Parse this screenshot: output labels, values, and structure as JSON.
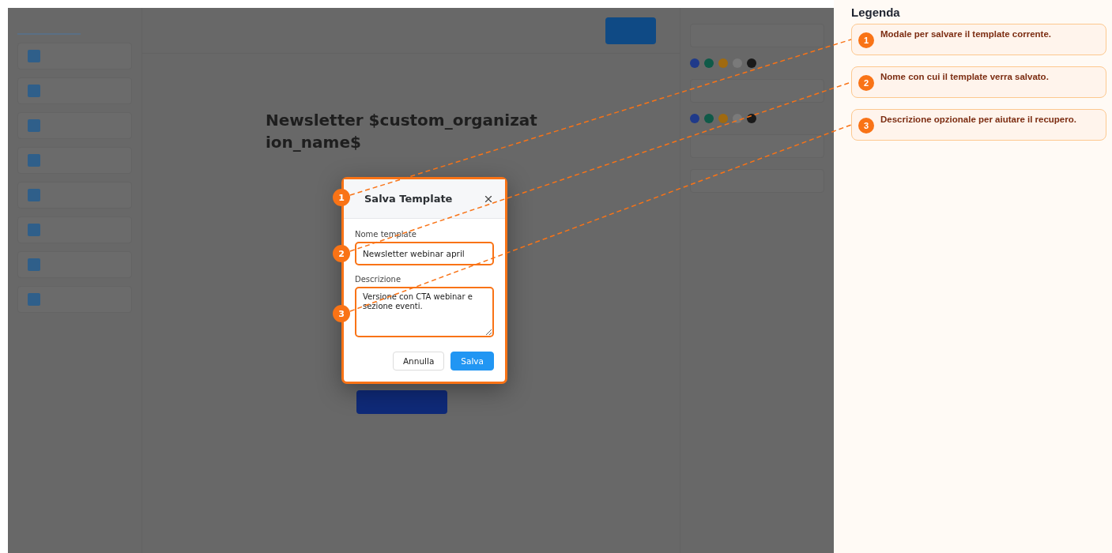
{
  "background": {
    "heading": "Newsletter $custom_organization_name$"
  },
  "modal": {
    "title": "Salva Template",
    "fields": [
      {
        "kind": "input",
        "label": "Nome template",
        "value": "Newsletter webinar april"
      },
      {
        "kind": "textarea",
        "label": "Descrizione",
        "value": "Versione con CTA webinar e sezione eventi."
      }
    ],
    "buttons": [
      {
        "label": "Annulla",
        "primary": false
      },
      {
        "label": "Salva",
        "primary": true
      }
    ]
  },
  "annotations": [
    {
      "number": "1"
    },
    {
      "number": "2"
    },
    {
      "number": "3"
    }
  ],
  "legend": {
    "title": "Legenda",
    "items": [
      {
        "number": "1",
        "text": "Modale per salvare il template corrente."
      },
      {
        "number": "2",
        "text": "Nome con cui il template verra salvato."
      },
      {
        "number": "3",
        "text": "Descrizione opzionale per aiutare il recupero."
      }
    ]
  }
}
